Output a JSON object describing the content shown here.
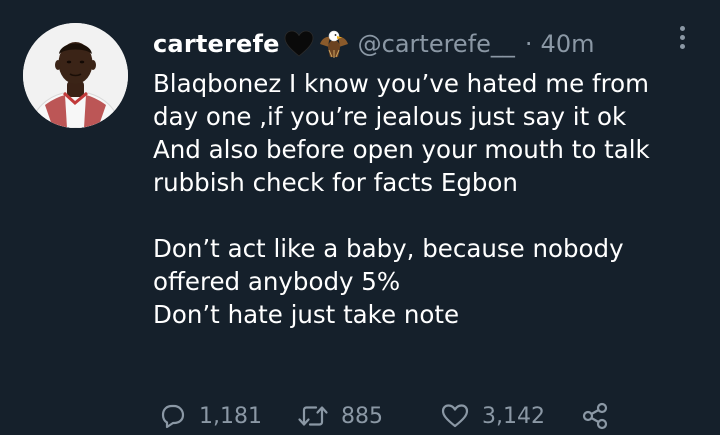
{
  "tweet": {
    "display_name": "carterefe",
    "badges": [
      "black-heart-icon",
      "eagle-icon"
    ],
    "handle": "@carterefe__",
    "separator": "·",
    "time": "40m",
    "lines": [
      "Blaqbonez I know you’ve hated me from",
      "day one ,if you’re jealous just say it ok",
      "And also before open your mouth to talk",
      "rubbish check for facts Egbon",
      "",
      "Don’t act like a baby, because nobody",
      "offered anybody 5%",
      "Don’t hate just take note"
    ]
  },
  "actions": {
    "reply_count": "1,181",
    "retweet_count": "885",
    "like_count": "3,142"
  },
  "colors": {
    "background": "#15202b",
    "text": "#ffffff",
    "muted": "#8b98a5"
  }
}
